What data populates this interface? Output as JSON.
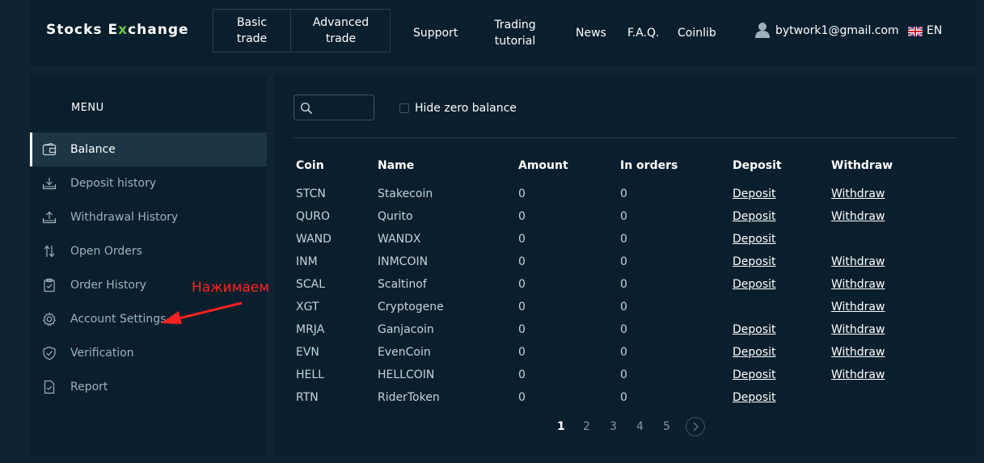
{
  "header": {
    "logo_part1": "Stocks E",
    "logo_x": "x",
    "logo_part2": "change",
    "basic_trade": "Basic trade",
    "advanced_trade": "Advanced trade",
    "nav": [
      "Support",
      "Trading tutorial",
      "News",
      "F.A.Q.",
      "Coinlib"
    ],
    "user_email": "bytwork1@gmail.com",
    "language": "EN"
  },
  "sidebar": {
    "title": "MENU",
    "items": [
      {
        "label": "Balance",
        "icon": "wallet-icon"
      },
      {
        "label": "Deposit history",
        "icon": "tray-in-icon"
      },
      {
        "label": "Withdrawal History",
        "icon": "tray-out-icon"
      },
      {
        "label": "Open Orders",
        "icon": "arrows-updown-icon"
      },
      {
        "label": "Order History",
        "icon": "clipboard-icon"
      },
      {
        "label": "Account Settings",
        "icon": "gear-icon"
      },
      {
        "label": "Verification",
        "icon": "shield-check-icon"
      },
      {
        "label": "Report",
        "icon": "document-check-icon"
      }
    ]
  },
  "annotation": "Нажимаем",
  "balance": {
    "hide_zero_label": "Hide zero balance",
    "columns": [
      "Coin",
      "Name",
      "Amount",
      "In orders",
      "Deposit",
      "Withdraw"
    ],
    "rows": [
      {
        "coin": "STCN",
        "name": "Stakecoin",
        "amount": "0",
        "in_orders": "0",
        "deposit": "Deposit",
        "withdraw": "Withdraw"
      },
      {
        "coin": "QURO",
        "name": "Qurito",
        "amount": "0",
        "in_orders": "0",
        "deposit": "Deposit",
        "withdraw": "Withdraw"
      },
      {
        "coin": "WAND",
        "name": "WANDX",
        "amount": "0",
        "in_orders": "0",
        "deposit": "Deposit",
        "withdraw": ""
      },
      {
        "coin": "INM",
        "name": "INMCOIN",
        "amount": "0",
        "in_orders": "0",
        "deposit": "Deposit",
        "withdraw": "Withdraw"
      },
      {
        "coin": "SCAL",
        "name": "Scaltinof",
        "amount": "0",
        "in_orders": "0",
        "deposit": "Deposit",
        "withdraw": "Withdraw"
      },
      {
        "coin": "XGT",
        "name": "Cryptogene",
        "amount": "0",
        "in_orders": "0",
        "deposit": "",
        "withdraw": "Withdraw"
      },
      {
        "coin": "MRJA",
        "name": "Ganjacoin",
        "amount": "0",
        "in_orders": "0",
        "deposit": "Deposit",
        "withdraw": "Withdraw"
      },
      {
        "coin": "EVN",
        "name": "EvenCoin",
        "amount": "0",
        "in_orders": "0",
        "deposit": "Deposit",
        "withdraw": "Withdraw"
      },
      {
        "coin": "HELL",
        "name": "HELLCOIN",
        "amount": "0",
        "in_orders": "0",
        "deposit": "Deposit",
        "withdraw": "Withdraw"
      },
      {
        "coin": "RTN",
        "name": "RiderToken",
        "amount": "0",
        "in_orders": "0",
        "deposit": "Deposit",
        "withdraw": ""
      }
    ],
    "pages": [
      "1",
      "2",
      "3",
      "4",
      "5"
    ]
  }
}
